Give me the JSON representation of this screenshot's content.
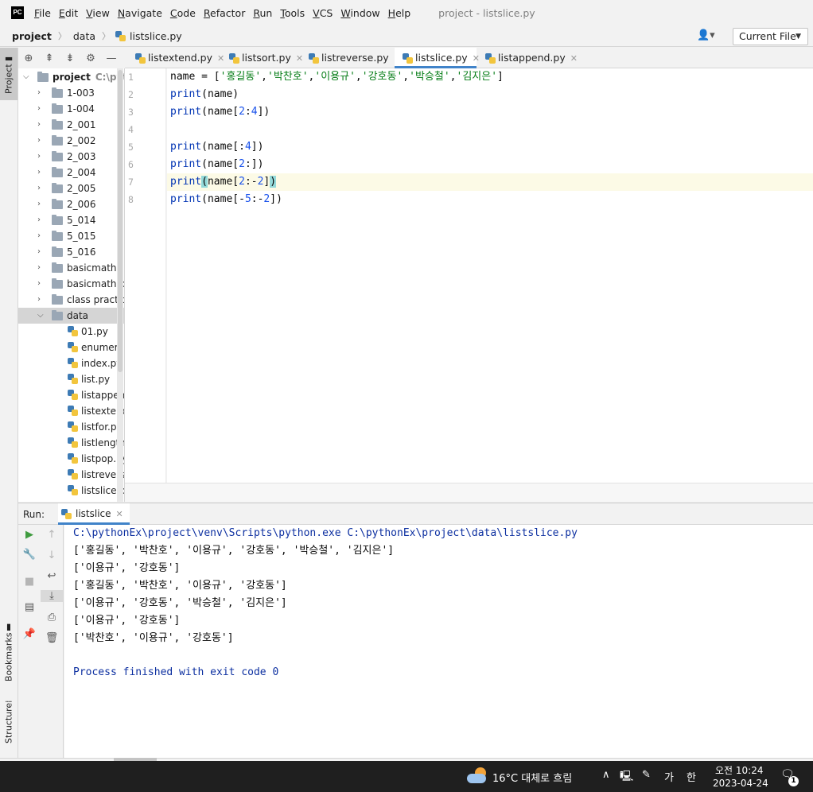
{
  "menubar": {
    "items": [
      {
        "u": "F",
        "rest": "ile"
      },
      {
        "u": "E",
        "rest": "dit"
      },
      {
        "u": "V",
        "rest": "iew"
      },
      {
        "u": "N",
        "rest": "avigate"
      },
      {
        "u": "C",
        "rest": "ode"
      },
      {
        "u": "R",
        "rest": "efactor"
      },
      {
        "u": "R",
        "rest": "un"
      },
      {
        "u": "T",
        "rest": "ools"
      },
      {
        "u": "V",
        "rest": "CS"
      },
      {
        "u": "W",
        "rest": "indow"
      },
      {
        "u": "H",
        "rest": "elp"
      }
    ],
    "title": "project - listslice.py",
    "logo": "PC"
  },
  "navbar": {
    "project": "project",
    "folder": "data",
    "file": "listslice.py",
    "current_file": "Current File"
  },
  "left_strip": {
    "project": "Project",
    "bookmarks": "Bookmarks",
    "structure": "Structure"
  },
  "tree": {
    "root": "project",
    "root_path": "C:\\pythonEx\\project",
    "folders": [
      "1-003",
      "1-004",
      "2_001",
      "2_002",
      "2_003",
      "2_004",
      "2_005",
      "2_006",
      "5_014",
      "5_015",
      "5_016",
      "basicmath",
      "basicmath practice",
      "class practice"
    ],
    "open_folder": "data",
    "files": [
      "01.py",
      "enumerate.py",
      "index.py",
      "list.py",
      "listappend.py",
      "listextend.py",
      "listfor.py",
      "listlength.py",
      "listpop.py",
      "listreverse.py",
      "listslice.py"
    ]
  },
  "tabs": [
    {
      "label": "listextend.py",
      "active": false
    },
    {
      "label": "listsort.py",
      "active": false
    },
    {
      "label": "listreverse.py",
      "active": false
    },
    {
      "label": "listslice.py",
      "active": true
    },
    {
      "label": "listappend.py",
      "active": false
    }
  ],
  "editor": {
    "line_numbers": [
      "1",
      "2",
      "3",
      "4",
      "5",
      "6",
      "7",
      "8"
    ],
    "line1": {
      "a": "name = [",
      "s1": "'홍길동'",
      "c1": ",",
      "s2": "'박찬호'",
      "c2": ",",
      "s3": "'이용규'",
      "c3": ",",
      "s4": "'강호동'",
      "c4": ",",
      "s5": "'박승철'",
      "c5": ",",
      "s6": "'김지은'",
      "end": "]"
    },
    "line2": {
      "kw": "print",
      "rest": "(name)"
    },
    "line3": {
      "kw": "print",
      "a": "(name[",
      "n1": "2",
      "b": ":",
      "n2": "4",
      "c": "])"
    },
    "line5": {
      "kw": "print",
      "a": "(name[:",
      "n1": "4",
      "c": "])"
    },
    "line6": {
      "kw": "print",
      "a": "(name[",
      "n1": "2",
      "c": ":])"
    },
    "line7": {
      "kw": "print",
      "open": "(",
      "a": "name[",
      "n1": "2",
      "b": ":-",
      "n2": "2",
      "c": "]",
      "close": ")"
    },
    "line8": {
      "kw": "print",
      "a": "(name[-",
      "n1": "5",
      "b": ":-",
      "n2": "2",
      "c": "])"
    }
  },
  "run": {
    "label": "Run:",
    "tab": "listslice",
    "lines": [
      "C:\\pythonEx\\project\\venv\\Scripts\\python.exe C:\\pythonEx\\project\\data\\listslice.py",
      "['홍길동', '박찬호', '이용규', '강호동', '박승철', '김지은']",
      "['이용규', '강호동']",
      "['홍길동', '박찬호', '이용규', '강호동']",
      "['이용규', '강호동', '박승철', '김지은']",
      "['이용규', '강호동']",
      "['박찬호', '이용규', '강호동']",
      "",
      "Process finished with exit code 0"
    ]
  },
  "taskbar": {
    "weather": "16°C  대체로 흐림",
    "ime": "가",
    "ime2": "한",
    "time": "오전 10:24",
    "date": "2023-04-24",
    "notif_count": "1"
  }
}
